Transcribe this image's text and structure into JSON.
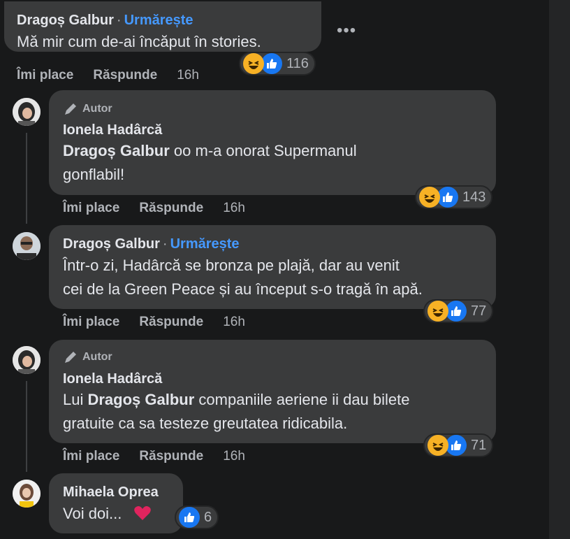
{
  "comments": [
    {
      "name": "Dragoș Galbur",
      "follow": "Urmărește",
      "text": "Mă mir cum de-ai încăput în stories.",
      "actions": {
        "like": "Îmi place",
        "reply": "Răspunde",
        "time": "16h"
      },
      "reactions": "116"
    },
    {
      "author_badge": "Autor",
      "name": "Ionela Hadârcă",
      "mention": "Dragoș Galbur",
      "text_line1": " oo m-a onorat Supermanul",
      "text_line2": "gonflabil!",
      "actions": {
        "like": "Îmi place",
        "reply": "Răspunde",
        "time": "16h"
      },
      "reactions": "143"
    },
    {
      "name": "Dragoș Galbur",
      "follow": "Urmărește",
      "text_line1": "Într-o zi, Hadârcă se bronza pe plajă, dar au venit",
      "text_line2": "cei de la Green Peace și au început s-o tragă în apă.",
      "actions": {
        "like": "Îmi place",
        "reply": "Răspunde",
        "time": "16h"
      },
      "reactions": "77"
    },
    {
      "author_badge": "Autor",
      "name": "Ionela Hadârcă",
      "prefix": "Lui ",
      "mention": "Dragoș Galbur",
      "text_line1": " companiile aeriene ii dau bilete",
      "text_line2": "gratuite ca sa testeze greutatea ridicabila.",
      "actions": {
        "like": "Îmi place",
        "reply": "Răspunde",
        "time": "16h"
      },
      "reactions": "71"
    },
    {
      "name": "Mihaela Oprea",
      "text": "Voi doi...",
      "reactions": "6"
    }
  ],
  "more_menu": "•••",
  "colors": {
    "background": "#18191a",
    "bubble": "#3a3b3c",
    "link": "#4599ff",
    "muted": "#b0b3b8"
  }
}
